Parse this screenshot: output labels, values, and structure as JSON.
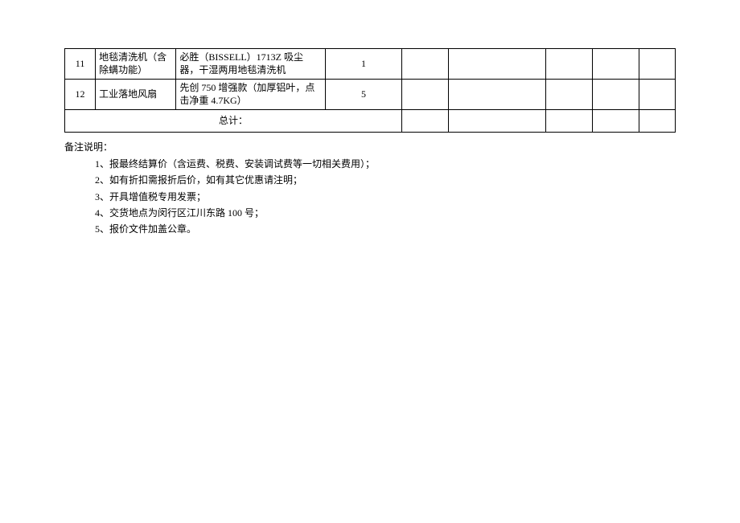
{
  "table": {
    "rows": [
      {
        "num": "11",
        "name": "地毯清洗机（含除螨功能）",
        "spec": "必胜（BISSELL）1713Z 吸尘器，干湿两用地毯清洗机",
        "qty": "1",
        "a": "",
        "b": "",
        "c": "",
        "d": "",
        "e": ""
      },
      {
        "num": "12",
        "name": "工业落地风扇",
        "spec": "先创 750 增强款（加厚铝叶，点击净重 4.7KG）",
        "qty": "5",
        "a": "",
        "b": "",
        "c": "",
        "d": "",
        "e": ""
      }
    ],
    "total_label": "总计：",
    "total_a": "",
    "total_b": "",
    "total_c": "",
    "total_d": "",
    "total_e": ""
  },
  "notes": {
    "title": "备注说明：",
    "items": [
      "1、报最终结算价（含运费、税费、安装调试费等一切相关费用）；",
      "2、如有折扣需报折后价，如有其它优惠请注明；",
      "3、开具增值税专用发票；",
      "4、交货地点为闵行区江川东路 100 号；",
      "5、报价文件加盖公章。"
    ]
  }
}
